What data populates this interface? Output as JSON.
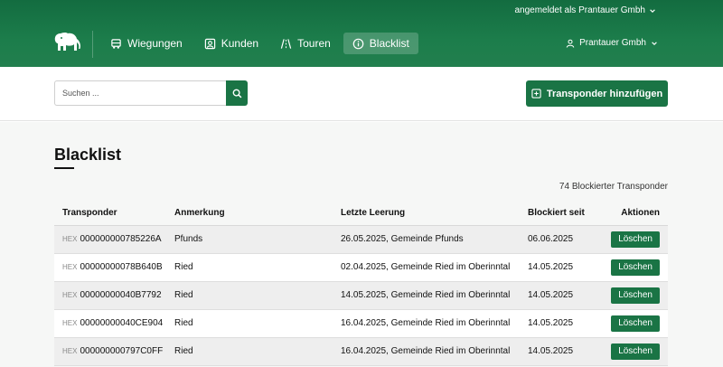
{
  "header": {
    "logged_in_as": "angemeldet als Prantauer Gmbh",
    "nav": [
      {
        "label": "Wiegungen",
        "icon": "truck-icon"
      },
      {
        "label": "Kunden",
        "icon": "person-card-icon"
      },
      {
        "label": "Touren",
        "icon": "road-icon"
      },
      {
        "label": "Blacklist",
        "icon": "info-circle-icon",
        "active": true
      }
    ],
    "user_name": "Prantauer Gmbh"
  },
  "toolbar": {
    "search_placeholder": "Suchen ...",
    "add_label": "Transponder hinzufügen"
  },
  "main": {
    "title": "Blacklist",
    "count_text": "74 Blockierter Transponder",
    "columns": [
      "Transponder",
      "Anmerkung",
      "Letzte Leerung",
      "Blockiert seit",
      "Aktionen"
    ],
    "hex_prefix": "HEX",
    "delete_label": "Löschen",
    "rows": [
      {
        "transponder": "000000000785226A",
        "note": "Pfunds",
        "last": "26.05.2025, Gemeinde Pfunds",
        "since": "06.06.2025"
      },
      {
        "transponder": "00000000078B640B",
        "note": "Ried",
        "last": "02.04.2025, Gemeinde Ried im Oberinntal",
        "since": "14.05.2025"
      },
      {
        "transponder": "00000000040B7792",
        "note": "Ried",
        "last": "14.05.2025, Gemeinde Ried im Oberinntal",
        "since": "14.05.2025"
      },
      {
        "transponder": "00000000040CE904",
        "note": "Ried",
        "last": "16.04.2025, Gemeinde Ried im Oberinntal",
        "since": "14.05.2025"
      },
      {
        "transponder": "000000000797C0FF",
        "note": "Ried",
        "last": "16.04.2025, Gemeinde Ried im Oberinntal",
        "since": "14.05.2025"
      }
    ]
  },
  "colors": {
    "brand_green": "#1a7445",
    "header_green": "#1c7d4b"
  }
}
